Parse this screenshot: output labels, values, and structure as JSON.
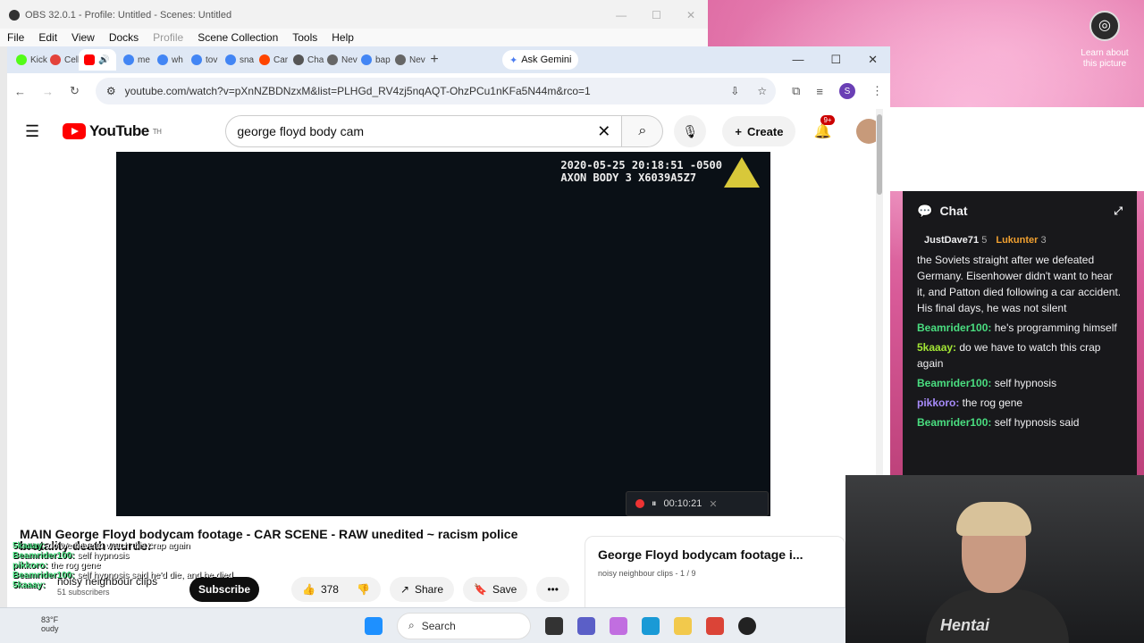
{
  "obs": {
    "title": "OBS 32.0.1 - Profile: Untitled - Scenes: Untitled",
    "menu": [
      "File",
      "Edit",
      "View",
      "Docks",
      "Profile",
      "Scene Collection",
      "Tools",
      "Help"
    ]
  },
  "desktop": {
    "learn_line1": "Learn about",
    "learn_line2": "this picture"
  },
  "browser": {
    "tabs": [
      "Kick",
      "Cell",
      "",
      "me",
      "wh",
      "tov",
      "sna",
      "Car",
      "Cha",
      "Nev",
      "bap",
      "Nev"
    ],
    "gemini": "Ask Gemini",
    "url": "youtube.com/watch?v=pXnNZBDNzxM&list=PLHGd_RV4zj5nqAQT-OhzPCu1nKFa5N44m&rco=1",
    "profile": "S"
  },
  "youtube": {
    "logo": "YouTube",
    "region": "TH",
    "search_value": "george floyd body cam",
    "create": "Create",
    "notif": "9+",
    "stamp1": "2020-05-25 20:18:51 -0500",
    "stamp2": "AXON BODY 3 X6039A5Z7",
    "rec_time": "00:10:21",
    "title": "MAIN George Floyd bodycam footage - CAR SCENE - RAW unedited ~ racism police brutality death murder",
    "channel": "noisy neighbour clips",
    "subscribers": "51 subscribers",
    "subscribe": "Subscribe",
    "likes": "378",
    "share": "Share",
    "save": "Save",
    "playlist_title": "George Floyd bodycam footage i...",
    "playlist_sub": "noisy neighbour clips - 1 / 9"
  },
  "overlay": [
    {
      "user": "5kaaay:",
      "text": " do we have to watch this crap again"
    },
    {
      "user": "Beamrider100:",
      "text": " self hypnosis"
    },
    {
      "user": "pikkoro:",
      "text": " the rog gene"
    },
    {
      "user": "Beamrider100:",
      "text": " self hypnosis said he'd die, and he died"
    },
    {
      "user": "5kaaay:",
      "text": ""
    }
  ],
  "chat": {
    "title": "Chat",
    "gift1": "JustDave71",
    "gift1n": "5",
    "gift2": "Lukunter",
    "gift2n": "3",
    "messages": [
      {
        "user": "",
        "color": "#efeff1",
        "text": "the Soviets straight after we defeated Germany. Eisenhower didn't want to hear it, and Patton died following a car accident. His final days, he was not silent"
      },
      {
        "user": "Beamrider100:",
        "color": "#4ade80",
        "text": " he's programming himself"
      },
      {
        "user": "5kaaay:",
        "color": "#a3e635",
        "text": " do we have to watch this crap again"
      },
      {
        "user": "Beamrider100:",
        "color": "#4ade80",
        "text": " self hypnosis"
      },
      {
        "user": "pikkoro:",
        "color": "#a78bfa",
        "text": " the rog gene"
      },
      {
        "user": "Beamrider100:",
        "color": "#4ade80",
        "text": " self hypnosis said"
      }
    ]
  },
  "cam": {
    "shirt": "Hentai"
  },
  "taskbar": {
    "search": "Search",
    "temp": "83°F",
    "cond": "oudy"
  }
}
